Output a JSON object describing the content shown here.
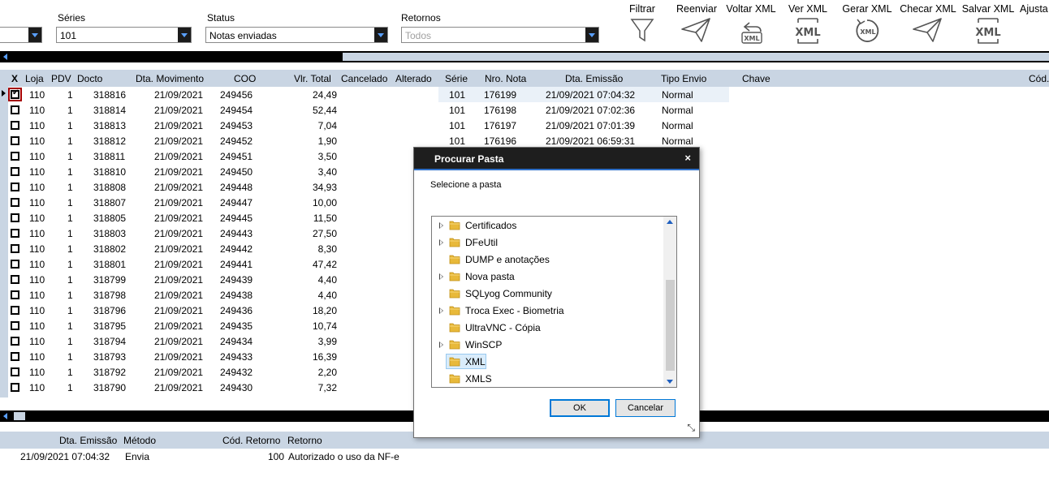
{
  "filters": {
    "series_label": "Séries",
    "series_value": "101",
    "status_label": "Status",
    "status_value": "Notas enviadas",
    "returns_label": "Retornos",
    "returns_placeholder": "Todos"
  },
  "toolbar": {
    "filter": "Filtrar",
    "resend": "Reenviar",
    "revert_xml": "Voltar XML",
    "view_xml": "Ver XML",
    "generate_xml": "Gerar XML",
    "check_xml": "Checar XML",
    "save_xml": "Salvar XML",
    "adjust": "Ajusta"
  },
  "grid": {
    "columns": [
      "X",
      "Loja",
      "PDV",
      "Docto",
      "Dta. Movimento",
      "COO",
      "Vlr. Total",
      "Cancelado",
      "Alterado",
      "Série",
      "Nro. Nota",
      "Dta. Emissão",
      "Tipo Envio",
      "Chave",
      "Cód. Reto"
    ],
    "rows": [
      {
        "checked": true,
        "loja": "110",
        "pdv": "1",
        "docto": "318816",
        "dta": "21/09/2021",
        "coo": "249456",
        "vlr": "24,49",
        "serie": "101",
        "nota": "176199",
        "emissao": "21/09/2021 07:04:32",
        "tipo": "Normal"
      },
      {
        "checked": false,
        "loja": "110",
        "pdv": "1",
        "docto": "318814",
        "dta": "21/09/2021",
        "coo": "249454",
        "vlr": "52,44",
        "serie": "101",
        "nota": "176198",
        "emissao": "21/09/2021 07:02:36",
        "tipo": "Normal"
      },
      {
        "checked": false,
        "loja": "110",
        "pdv": "1",
        "docto": "318813",
        "dta": "21/09/2021",
        "coo": "249453",
        "vlr": "7,04",
        "serie": "101",
        "nota": "176197",
        "emissao": "21/09/2021 07:01:39",
        "tipo": "Normal"
      },
      {
        "checked": false,
        "loja": "110",
        "pdv": "1",
        "docto": "318812",
        "dta": "21/09/2021",
        "coo": "249452",
        "vlr": "1,90",
        "serie": "101",
        "nota": "176196",
        "emissao": "21/09/2021 06:59:31",
        "tipo": "Normal"
      },
      {
        "checked": false,
        "loja": "110",
        "pdv": "1",
        "docto": "318811",
        "dta": "21/09/2021",
        "coo": "249451",
        "vlr": "3,50"
      },
      {
        "checked": false,
        "loja": "110",
        "pdv": "1",
        "docto": "318810",
        "dta": "21/09/2021",
        "coo": "249450",
        "vlr": "3,40"
      },
      {
        "checked": false,
        "loja": "110",
        "pdv": "1",
        "docto": "318808",
        "dta": "21/09/2021",
        "coo": "249448",
        "vlr": "34,93"
      },
      {
        "checked": false,
        "loja": "110",
        "pdv": "1",
        "docto": "318807",
        "dta": "21/09/2021",
        "coo": "249447",
        "vlr": "10,00"
      },
      {
        "checked": false,
        "loja": "110",
        "pdv": "1",
        "docto": "318805",
        "dta": "21/09/2021",
        "coo": "249445",
        "vlr": "11,50"
      },
      {
        "checked": false,
        "loja": "110",
        "pdv": "1",
        "docto": "318803",
        "dta": "21/09/2021",
        "coo": "249443",
        "vlr": "27,50"
      },
      {
        "checked": false,
        "loja": "110",
        "pdv": "1",
        "docto": "318802",
        "dta": "21/09/2021",
        "coo": "249442",
        "vlr": "8,30"
      },
      {
        "checked": false,
        "loja": "110",
        "pdv": "1",
        "docto": "318801",
        "dta": "21/09/2021",
        "coo": "249441",
        "vlr": "47,42"
      },
      {
        "checked": false,
        "loja": "110",
        "pdv": "1",
        "docto": "318799",
        "dta": "21/09/2021",
        "coo": "249439",
        "vlr": "4,40"
      },
      {
        "checked": false,
        "loja": "110",
        "pdv": "1",
        "docto": "318798",
        "dta": "21/09/2021",
        "coo": "249438",
        "vlr": "4,40"
      },
      {
        "checked": false,
        "loja": "110",
        "pdv": "1",
        "docto": "318796",
        "dta": "21/09/2021",
        "coo": "249436",
        "vlr": "18,20"
      },
      {
        "checked": false,
        "loja": "110",
        "pdv": "1",
        "docto": "318795",
        "dta": "21/09/2021",
        "coo": "249435",
        "vlr": "10,74"
      },
      {
        "checked": false,
        "loja": "110",
        "pdv": "1",
        "docto": "318794",
        "dta": "21/09/2021",
        "coo": "249434",
        "vlr": "3,99"
      },
      {
        "checked": false,
        "loja": "110",
        "pdv": "1",
        "docto": "318793",
        "dta": "21/09/2021",
        "coo": "249433",
        "vlr": "16,39"
      },
      {
        "checked": false,
        "loja": "110",
        "pdv": "1",
        "docto": "318792",
        "dta": "21/09/2021",
        "coo": "249432",
        "vlr": "2,20"
      },
      {
        "checked": false,
        "loja": "110",
        "pdv": "1",
        "docto": "318790",
        "dta": "21/09/2021",
        "coo": "249430",
        "vlr": "7,32"
      }
    ]
  },
  "bottom_grid": {
    "columns": [
      "Dta. Emissão",
      "Método",
      "Cód. Retorno",
      "Retorno"
    ],
    "row": {
      "emissao": "21/09/2021 07:04:32",
      "metodo": "Envia",
      "cod": "100",
      "retorno": "Autorizado o uso da NF-e"
    }
  },
  "dialog": {
    "title": "Procurar Pasta",
    "close": "×",
    "prompt": "Selecione a pasta",
    "folders": [
      {
        "name": "Certificados",
        "expandable": true
      },
      {
        "name": "DFeUtil",
        "expandable": true
      },
      {
        "name": "DUMP e anotações",
        "expandable": false
      },
      {
        "name": "Nova pasta",
        "expandable": true
      },
      {
        "name": "SQLyog Community",
        "expandable": false
      },
      {
        "name": "Troca Exec - Biometria",
        "expandable": true
      },
      {
        "name": "UltraVNC - Cópia",
        "expandable": false
      },
      {
        "name": "WinSCP",
        "expandable": true
      },
      {
        "name": "XML",
        "expandable": false,
        "selected": true
      },
      {
        "name": "XMLS",
        "expandable": false
      }
    ],
    "ok": "OK",
    "cancel": "Cancelar"
  },
  "colors": {
    "header_bg": "#c9d5e3",
    "title_bar": "#1e1e1e",
    "accent": "#0078d7",
    "checkbox_focus": "#a50000"
  }
}
